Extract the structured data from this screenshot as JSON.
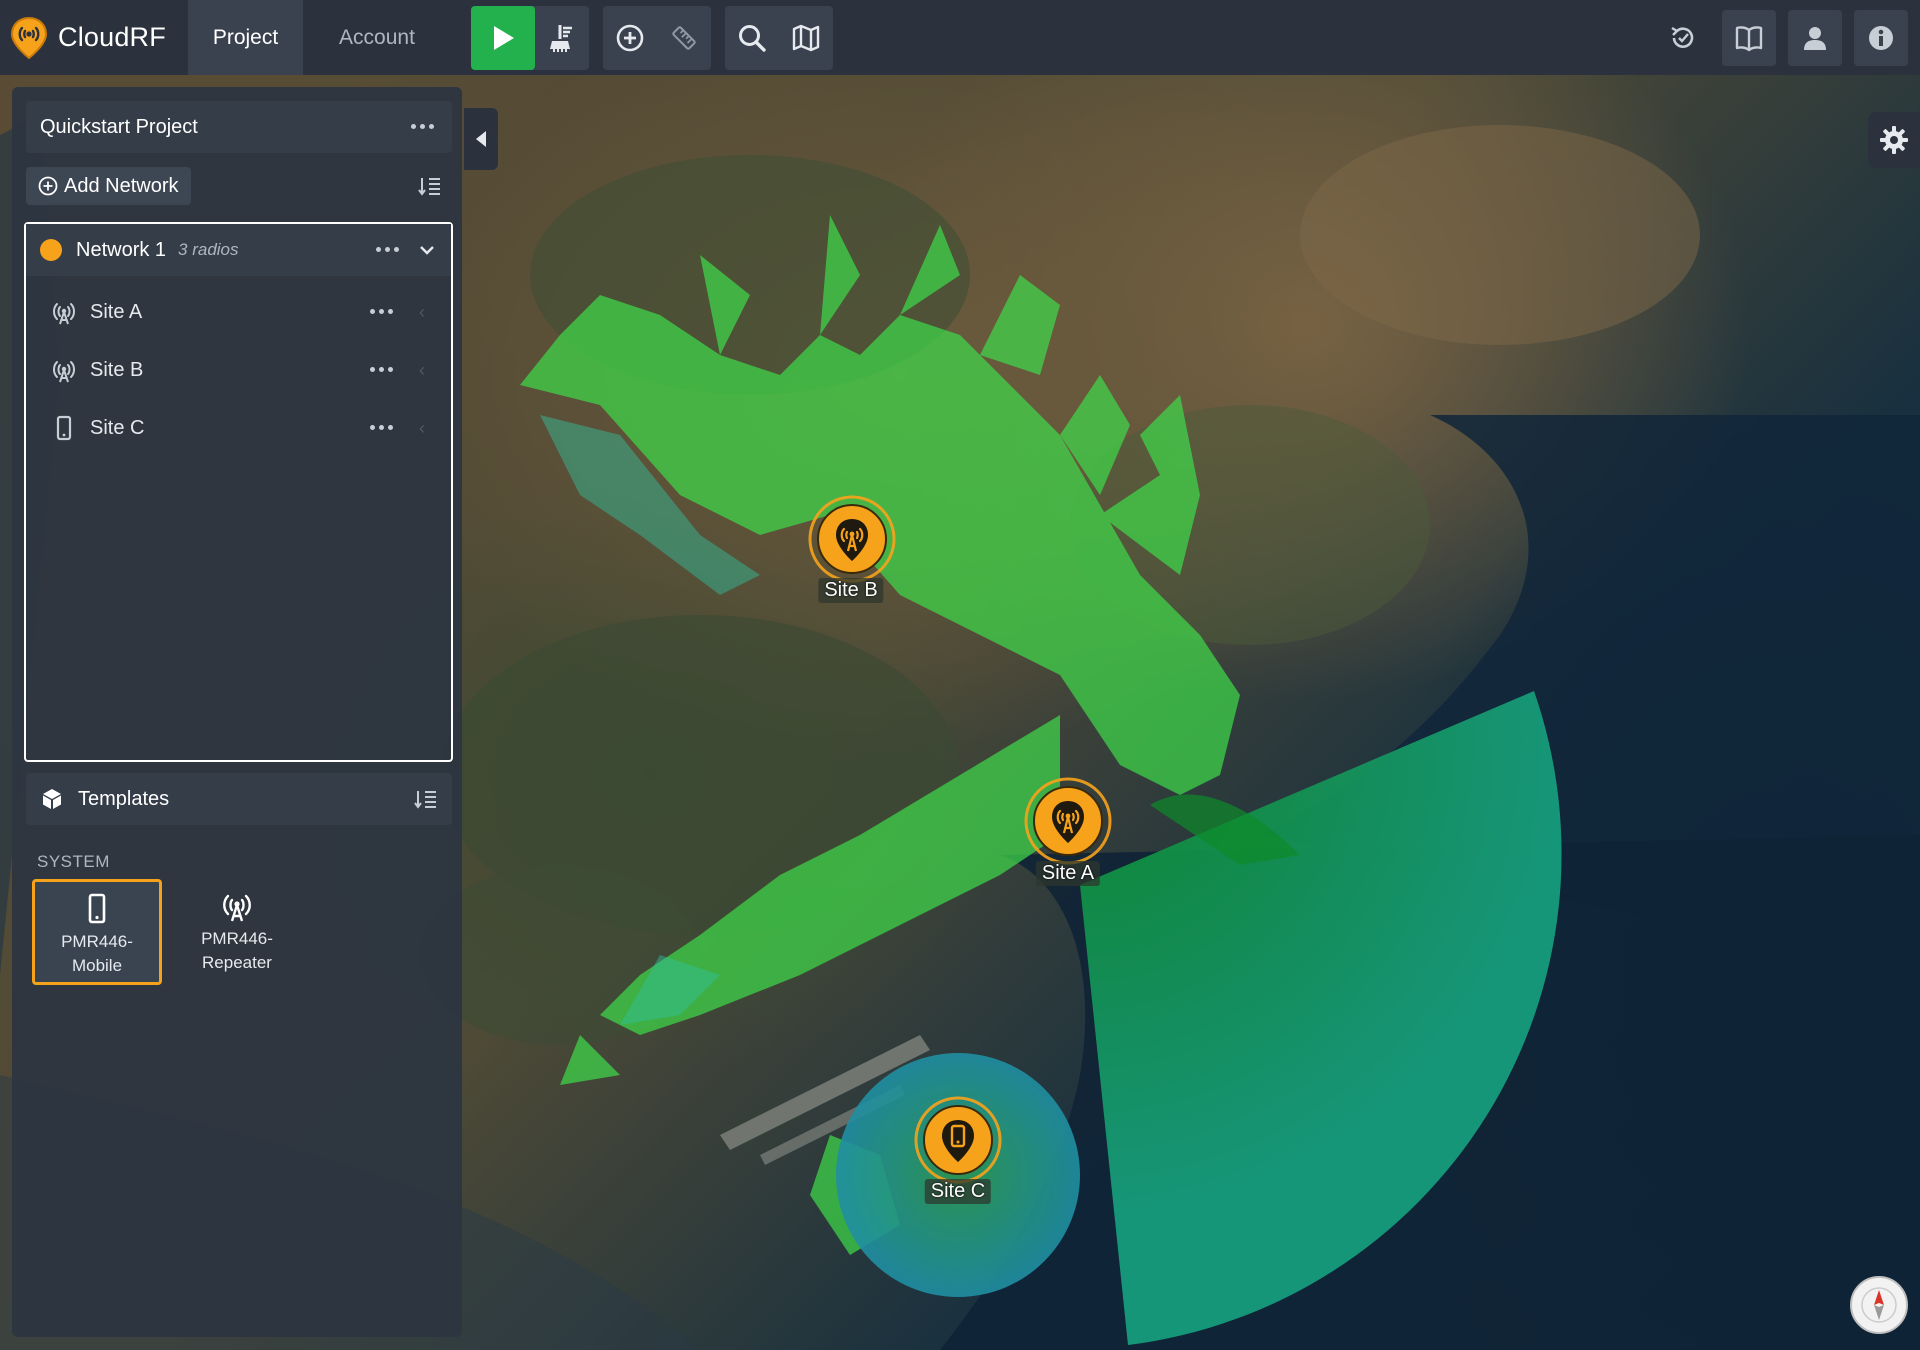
{
  "app": {
    "name": "CloudRF",
    "logo_icon": "cloudrf-logo-icon",
    "accent_color": "#f7a21b",
    "run_color": "#22b14c"
  },
  "nav": {
    "tabs": [
      {
        "label": "Project",
        "active": true
      },
      {
        "label": "Account",
        "active": false
      }
    ]
  },
  "toolbar": {
    "groups": [
      [
        "play-icon",
        "clear-coverage-icon"
      ],
      [
        "add-site-icon",
        "ruler-icon"
      ],
      [
        "search-icon",
        "map-layers-icon"
      ]
    ],
    "right": [
      "history-icon",
      "docs-book-icon",
      "user-icon",
      "info-icon"
    ]
  },
  "project": {
    "title": "Quickstart Project",
    "add_network_label": "Add Network"
  },
  "network": {
    "name": "Network 1",
    "count": "3 radios",
    "color": "#f7a21b",
    "sites": [
      {
        "name": "Site A",
        "icon": "antenna-icon"
      },
      {
        "name": "Site B",
        "icon": "antenna-icon"
      },
      {
        "name": "Site C",
        "icon": "mobile-icon"
      }
    ]
  },
  "templates": {
    "title": "Templates",
    "section": "SYSTEM",
    "items": [
      {
        "line1": "PMR446-",
        "line2": "Mobile",
        "icon": "mobile-icon",
        "selected": true
      },
      {
        "line1": "PMR446-",
        "line2": "Repeater",
        "icon": "antenna-icon",
        "selected": false
      }
    ]
  },
  "map": {
    "markers": [
      {
        "label": "Site A",
        "icon": "antenna-icon"
      },
      {
        "label": "Site B",
        "icon": "antenna-icon"
      },
      {
        "label": "Site C",
        "icon": "mobile-icon"
      }
    ],
    "coverage_color": "#3fd84a",
    "sector_color": "#169a6a"
  }
}
